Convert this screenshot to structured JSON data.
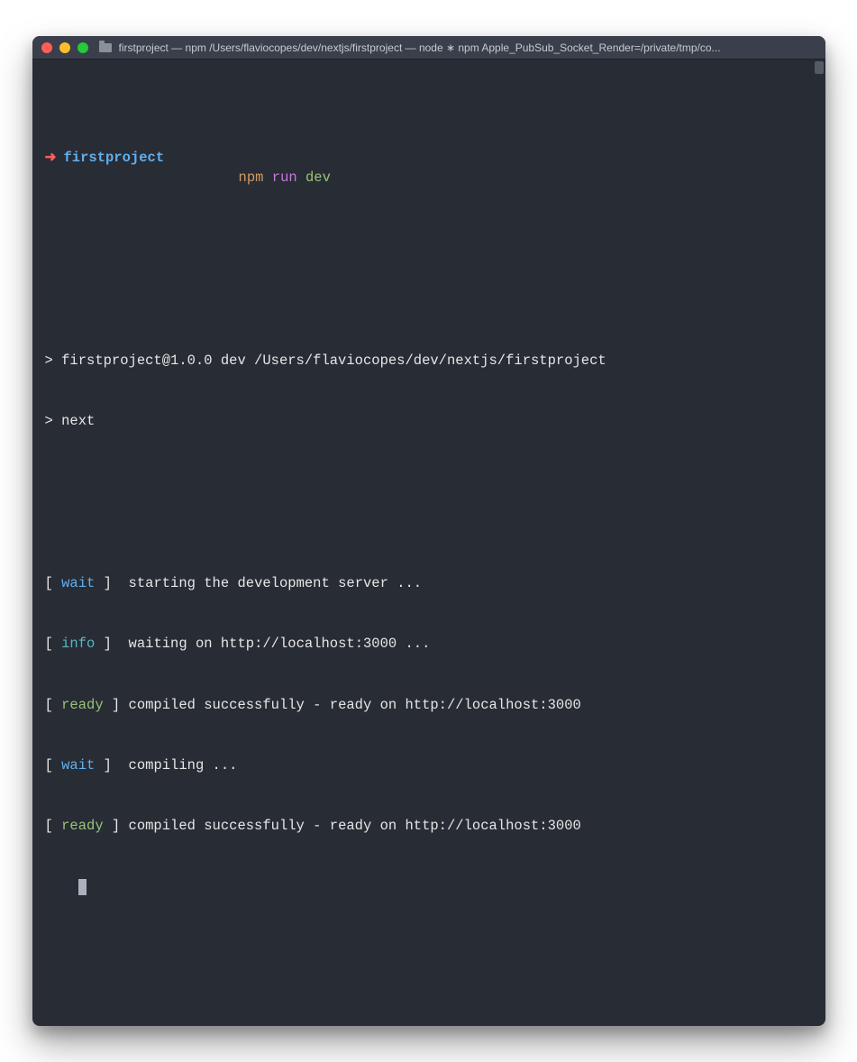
{
  "window": {
    "title": "firstproject — npm   /Users/flaviocopes/dev/nextjs/firstproject — node ∗ npm Apple_PubSub_Socket_Render=/private/tmp/co..."
  },
  "prompt": {
    "arrow": "➜",
    "project": "firstproject",
    "cmd_npm": "npm",
    "cmd_run": "run",
    "cmd_dev": "dev"
  },
  "output": {
    "header1_prefix": "> ",
    "header1": "firstproject@1.0.0 dev /Users/flaviocopes/dev/nextjs/firstproject",
    "header2_prefix": "> ",
    "header2": "next",
    "lines": [
      {
        "lb": "[ ",
        "tag": "wait",
        "rb": " ]  ",
        "msg": "starting the development server ...",
        "cls": "tag-wait"
      },
      {
        "lb": "[ ",
        "tag": "info",
        "rb": " ]  ",
        "msg": "waiting on http://localhost:3000 ...",
        "cls": "tag-info"
      },
      {
        "lb": "[ ",
        "tag": "ready",
        "rb": " ] ",
        "msg": "compiled successfully - ready on http://localhost:3000",
        "cls": "tag-ready"
      },
      {
        "lb": "[ ",
        "tag": "wait",
        "rb": " ]  ",
        "msg": "compiling ...",
        "cls": "tag-wait"
      },
      {
        "lb": "[ ",
        "tag": "ready",
        "rb": " ] ",
        "msg": "compiled successfully - ready on http://localhost:3000",
        "cls": "tag-ready"
      }
    ]
  }
}
